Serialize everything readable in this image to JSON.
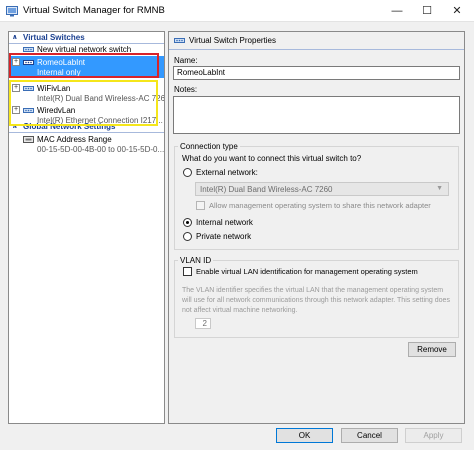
{
  "window": {
    "title": "Virtual Switch Manager for RMNB"
  },
  "tree": {
    "header_switches": "Virtual Switches",
    "new_switch": "New virtual network switch",
    "items": [
      {
        "name": "RomeoLabInt",
        "detail": "Internal only",
        "selected": true
      },
      {
        "name": "WiFivLan",
        "detail": "Intel(R) Dual Band Wireless-AC 7260"
      },
      {
        "name": "WiredvLan",
        "detail": "Intel(R) Ethernet Connection I217..."
      }
    ],
    "header_global": "Global Network Settings",
    "mac": {
      "name": "MAC Address Range",
      "detail": "00-15-5D-00-4B-00 to 00-15-5D-0..."
    }
  },
  "props": {
    "title": "Virtual Switch Properties",
    "name_label": "Name:",
    "name_value": "RomeoLabInt",
    "notes_label": "Notes:",
    "notes_value": "",
    "conn_group": "Connection type",
    "conn_question": "What do you want to connect this virtual switch to?",
    "external_label": "External network:",
    "external_adapter": "Intel(R) Dual Band Wireless-AC 7260",
    "allow_mgmt_label": "Allow management operating system to share this network adapter",
    "internal_label": "Internal network",
    "private_label": "Private network",
    "conn_selected": "internal",
    "vlan_group": "VLAN ID",
    "vlan_enable_label": "Enable virtual LAN identification for management operating system",
    "vlan_desc": "The VLAN identifier specifies the virtual LAN that the management operating system will use for all network communications through this network adapter. This setting does not affect virtual machine networking.",
    "vlan_value": "2",
    "remove_label": "Remove"
  },
  "footer": {
    "ok": "OK",
    "cancel": "Cancel",
    "apply": "Apply"
  },
  "colors": {
    "selection": "#3399ff",
    "highlight_red": "#d9232a",
    "highlight_yellow": "#f5e61b",
    "header_text": "#1a3f8f"
  }
}
